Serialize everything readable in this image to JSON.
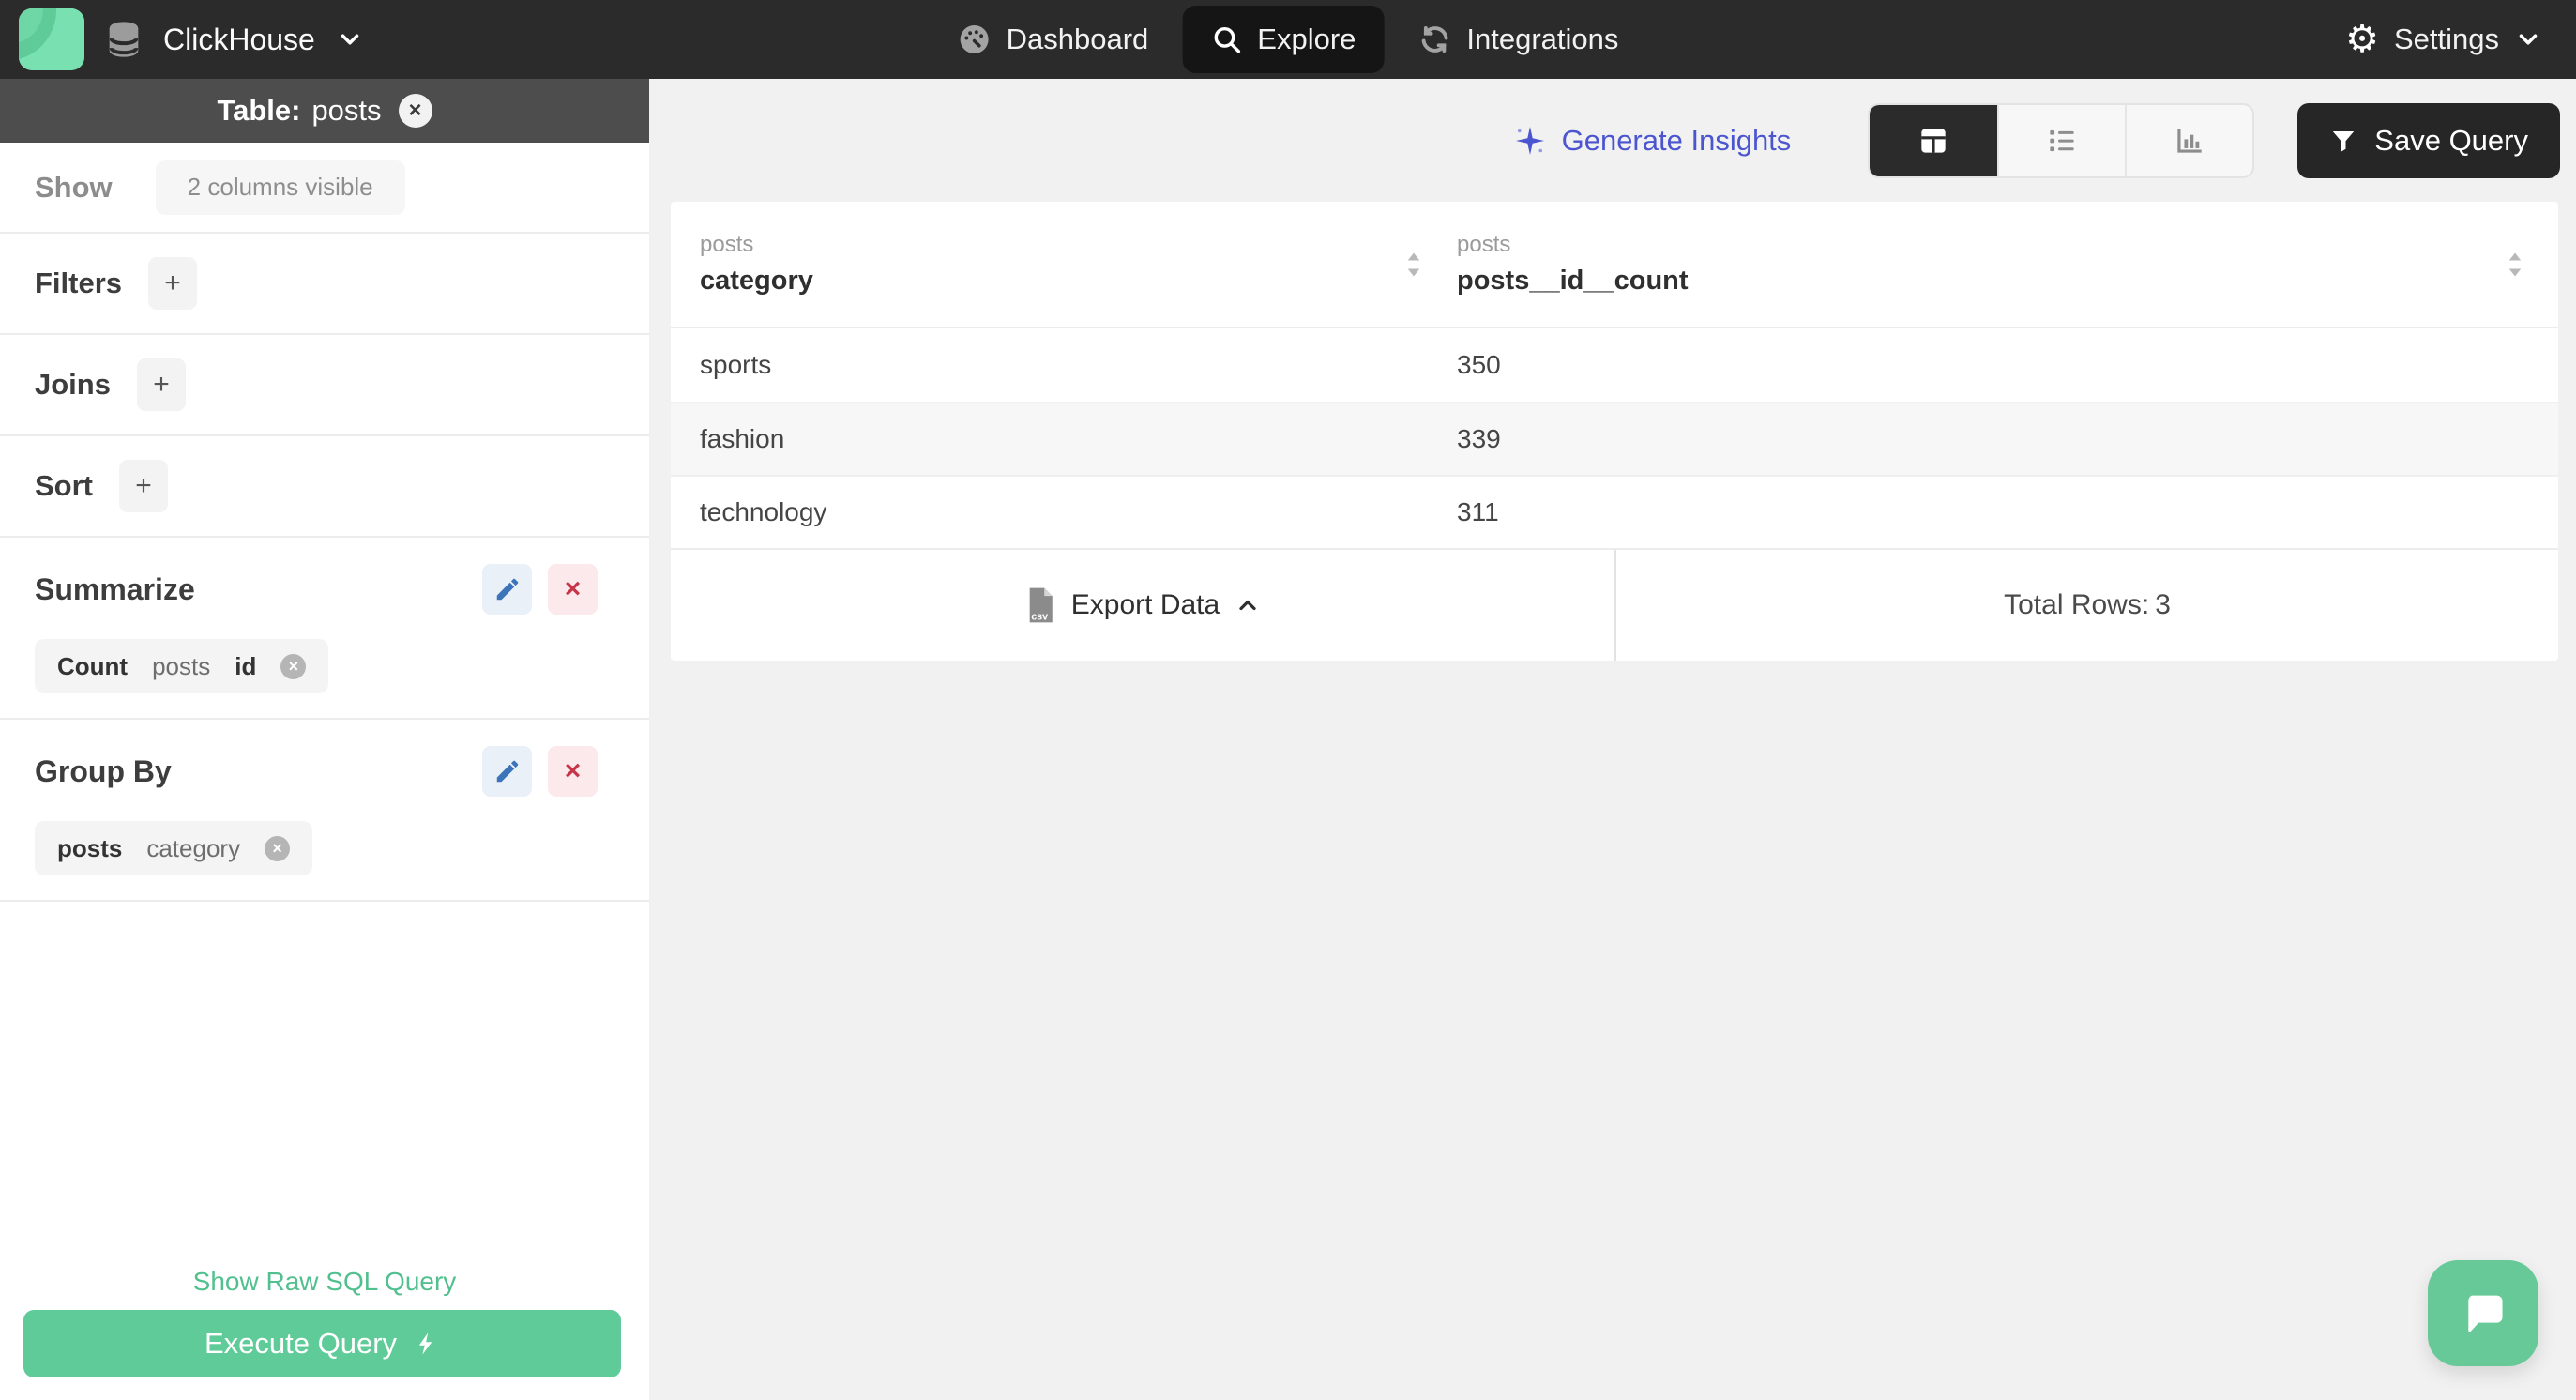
{
  "nav": {
    "brand": "ClickHouse",
    "items": [
      {
        "label": "Dashboard"
      },
      {
        "label": "Explore"
      },
      {
        "label": "Integrations"
      }
    ],
    "settings_label": "Settings"
  },
  "sidebar": {
    "table_label": "Table:",
    "table_name": "posts",
    "show_label": "Show",
    "show_value": "2 columns visible",
    "filters_label": "Filters",
    "joins_label": "Joins",
    "sort_label": "Sort",
    "summarize": {
      "title": "Summarize",
      "chip": {
        "agg": "Count",
        "table": "posts",
        "column": "id"
      }
    },
    "group_by": {
      "title": "Group By",
      "chip": {
        "table": "posts",
        "column": "category"
      }
    },
    "raw_sql_label": "Show Raw SQL Query",
    "execute_label": "Execute Query"
  },
  "toolbar": {
    "generate_insights_label": "Generate Insights",
    "save_query_label": "Save Query"
  },
  "table": {
    "columns": [
      {
        "group": "posts",
        "name": "category"
      },
      {
        "group": "posts",
        "name": "posts__id__count"
      }
    ],
    "rows": [
      [
        "sports",
        "350"
      ],
      [
        "fashion",
        "339"
      ],
      [
        "technology",
        "311"
      ]
    ],
    "export_label": "Export Data",
    "total_rows_label": "Total Rows:",
    "total_rows_value": "3"
  },
  "icons": {
    "plus": "+",
    "close": "×",
    "csv": "csv"
  },
  "colors": {
    "accent_green": "#5ecb98",
    "accent_indigo": "#4b55d0",
    "nav_bg": "#2b2b2b",
    "danger_red": "#c63649"
  }
}
